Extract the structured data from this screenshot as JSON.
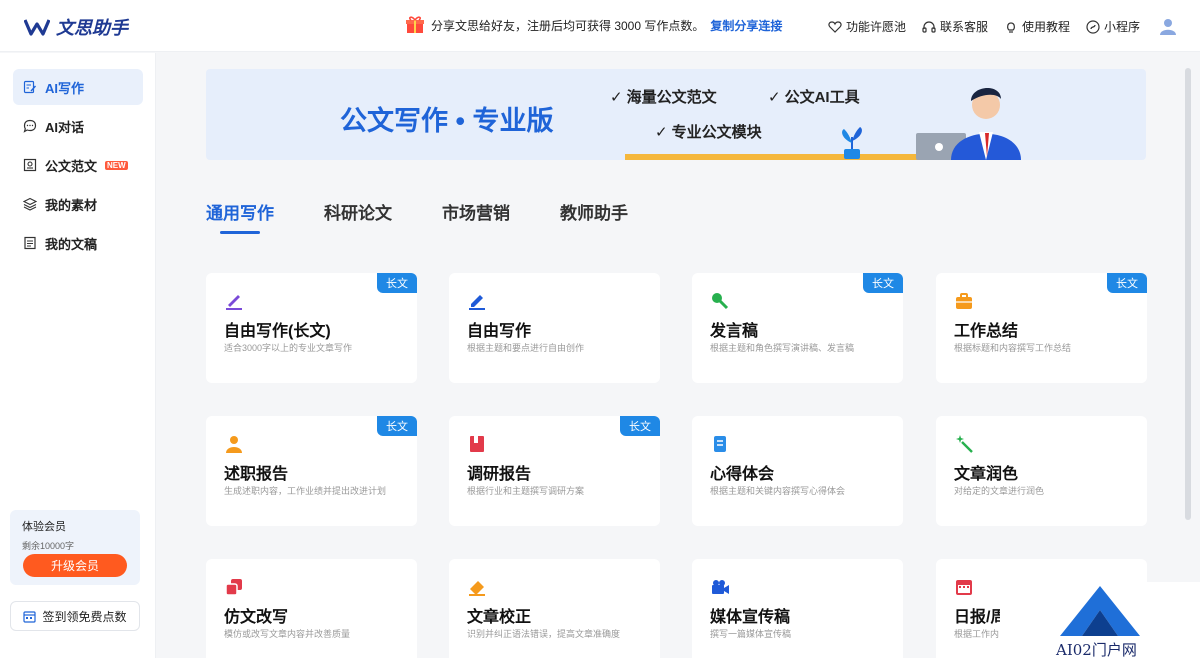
{
  "header": {
    "logo_text": "文思助手",
    "promo_text": "分享文思给好友，注册后均可获得 3000 写作点数。",
    "promo_link": "复制分享连接",
    "links": [
      "功能许愿池",
      "联系客服",
      "使用教程",
      "小程序"
    ],
    "link_icons": [
      "heart-icon",
      "headset-icon",
      "bulb-icon",
      "miniprogram-icon"
    ]
  },
  "sidebar": {
    "items": [
      {
        "label": "AI写作",
        "icon": "edit-doc-icon",
        "active": true
      },
      {
        "label": "AI对话",
        "icon": "chat-icon"
      },
      {
        "label": "公文范文",
        "icon": "doc-template-icon",
        "badge": "NEW"
      },
      {
        "label": "我的素材",
        "icon": "layers-icon"
      },
      {
        "label": "我的文稿",
        "icon": "file-icon"
      }
    ],
    "member": {
      "title": "体验会员",
      "remaining": "剩余10000字",
      "upgrade": "升级会员"
    },
    "signin": "签到领免费点数"
  },
  "banner": {
    "title": "公文写作 • 专业版",
    "features": [
      "海量公文范文",
      "公文AI工具",
      "专业公文模块"
    ]
  },
  "tabs": [
    "通用写作",
    "科研论文",
    "市场营销",
    "教师助手"
  ],
  "cards": [
    {
      "title": "自由写作(长文)",
      "desc": "适合3000字以上的专业文章写作",
      "tag": "长文",
      "icon": "pen-icon"
    },
    {
      "title": "自由写作",
      "desc": "根据主题和要点进行自由创作",
      "tag": "",
      "icon": "pencil-icon"
    },
    {
      "title": "发言稿",
      "desc": "根据主题和角色撰写演讲稿、发言稿",
      "tag": "长文",
      "icon": "microphone-icon"
    },
    {
      "title": "工作总结",
      "desc": "根据标题和内容撰写工作总结",
      "tag": "长文",
      "icon": "briefcase-icon"
    },
    {
      "title": "述职报告",
      "desc": "生成述职内容，工作业绩并提出改进计划",
      "tag": "长文",
      "icon": "person-icon"
    },
    {
      "title": "调研报告",
      "desc": "根据行业和主题撰写调研方案",
      "tag": "长文",
      "icon": "book-icon"
    },
    {
      "title": "心得体会",
      "desc": "根据主题和关键内容撰写心得体会",
      "tag": "",
      "icon": "notes-icon"
    },
    {
      "title": "文章润色",
      "desc": "对给定的文章进行润色",
      "tag": "",
      "icon": "magic-wand-icon"
    },
    {
      "title": "仿文改写",
      "desc": "模仿或改写文章内容并改善质量",
      "tag": "",
      "icon": "copy-icon"
    },
    {
      "title": "文章校正",
      "desc": "识别并纠正语法错误，提高文章准确度",
      "tag": "",
      "icon": "eraser-icon"
    },
    {
      "title": "媒体宣传稿",
      "desc": "撰写一篇媒体宣传稿",
      "tag": "",
      "icon": "video-camera-icon"
    },
    {
      "title": "日报/周",
      "desc": "根据工作内",
      "tag": "",
      "icon": "calendar-icon"
    }
  ],
  "watermark": "AI02门户网",
  "colors": {
    "accent": "#1f64d8",
    "tag": "#1f88e5",
    "upgrade": "#ff5a1f",
    "banner_bg": "#e6eefb"
  }
}
